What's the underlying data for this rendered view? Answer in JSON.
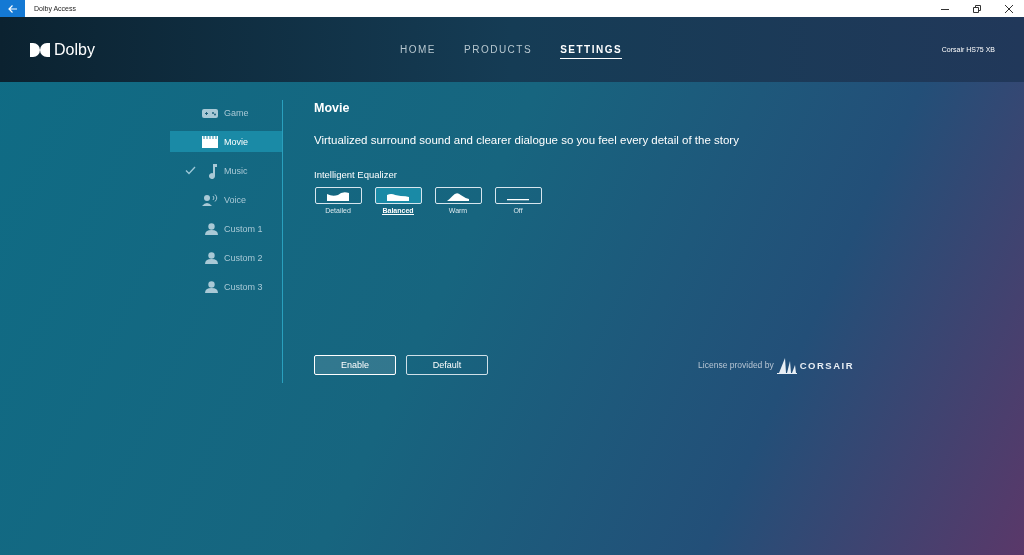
{
  "window": {
    "title": "Dolby Access"
  },
  "header": {
    "logo": "Dolby",
    "device": "Corsair HS75 XB"
  },
  "tabs": [
    {
      "label": "HOME",
      "selected": false
    },
    {
      "label": "PRODUCTS",
      "selected": false
    },
    {
      "label": "SETTINGS",
      "selected": true
    }
  ],
  "sidebar": {
    "items": [
      {
        "kind": "game",
        "label": "Game",
        "selected": false,
        "checked": false
      },
      {
        "kind": "movie",
        "label": "Movie",
        "selected": true,
        "checked": false
      },
      {
        "kind": "music",
        "label": "Music",
        "selected": false,
        "checked": true
      },
      {
        "kind": "voice",
        "label": "Voice",
        "selected": false,
        "checked": false
      },
      {
        "kind": "person",
        "label": "Custom 1",
        "selected": false,
        "checked": false
      },
      {
        "kind": "person",
        "label": "Custom 2",
        "selected": false,
        "checked": false
      },
      {
        "kind": "person",
        "label": "Custom 3",
        "selected": false,
        "checked": false
      }
    ]
  },
  "profile": {
    "title": "Movie",
    "description": "Virtualized surround sound and clearer dialogue so you feel every detail of the story"
  },
  "equalizer": {
    "label": "Intelligent Equalizer",
    "presets": [
      {
        "kind": "detailed",
        "label": "Detailed",
        "selected": false
      },
      {
        "kind": "balanced",
        "label": "Balanced",
        "selected": true
      },
      {
        "kind": "warm",
        "label": "Warm",
        "selected": false
      },
      {
        "kind": "off",
        "label": "Off",
        "selected": false
      }
    ]
  },
  "buttons": [
    {
      "label": "Enable",
      "selected": true
    },
    {
      "label": "Default",
      "selected": false
    }
  ],
  "license": {
    "text": "License provided by",
    "brand": "CORSAIR"
  }
}
